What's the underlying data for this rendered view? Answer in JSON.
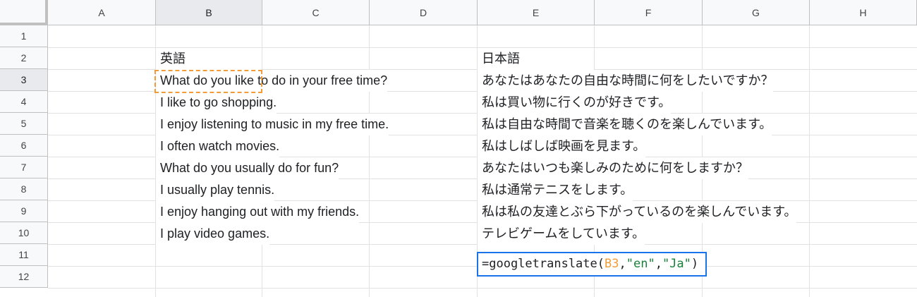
{
  "columns": [
    "A",
    "B",
    "C",
    "D",
    "E",
    "F",
    "G",
    "H"
  ],
  "rows": [
    "1",
    "2",
    "3",
    "4",
    "5",
    "6",
    "7",
    "8",
    "9",
    "10",
    "11",
    "12"
  ],
  "active_column": "B",
  "active_row": "3",
  "cells": {
    "B2": "英語",
    "E2": "日本語",
    "B3": "What do you like to do in your free time?",
    "E3": "あなたはあなたの自由な時間に何をしたいですか？",
    "B4": "I like to go shopping.",
    "E4": "私は買い物に行くのが好きです。",
    "B5": "I enjoy listening to music in my free time.",
    "E5": "私は自由な時間で音楽を聴くのを楽しんでいます。",
    "B6": "I often watch movies.",
    "E6": "私はしばしば映画を見ます。",
    "B7": "What do you usually do for fun?",
    "E7": "あなたはいつも楽しみのために何をしますか？",
    "B8": "I usually play tennis.",
    "E8": "私は通常テニスをします。",
    "B9": "I enjoy hanging out with my friends.",
    "E9": "私は私の友達とぶら下がっているのを楽しんでいます。",
    "B10": "I play video games.",
    "E10": "テレビゲームをしています。"
  },
  "editing_cell": {
    "ref": "E11",
    "formula_prefix": "=googletranslate(",
    "arg_ref": "B3",
    "sep1": ",",
    "arg_src": "\"en\"",
    "sep2": ",",
    "arg_dst": "\"Ja\"",
    "formula_suffix": ")"
  },
  "colors": {
    "selection_blue": "#1a73e8",
    "copy_orange": "#f29c38",
    "string_green": "#188038"
  }
}
